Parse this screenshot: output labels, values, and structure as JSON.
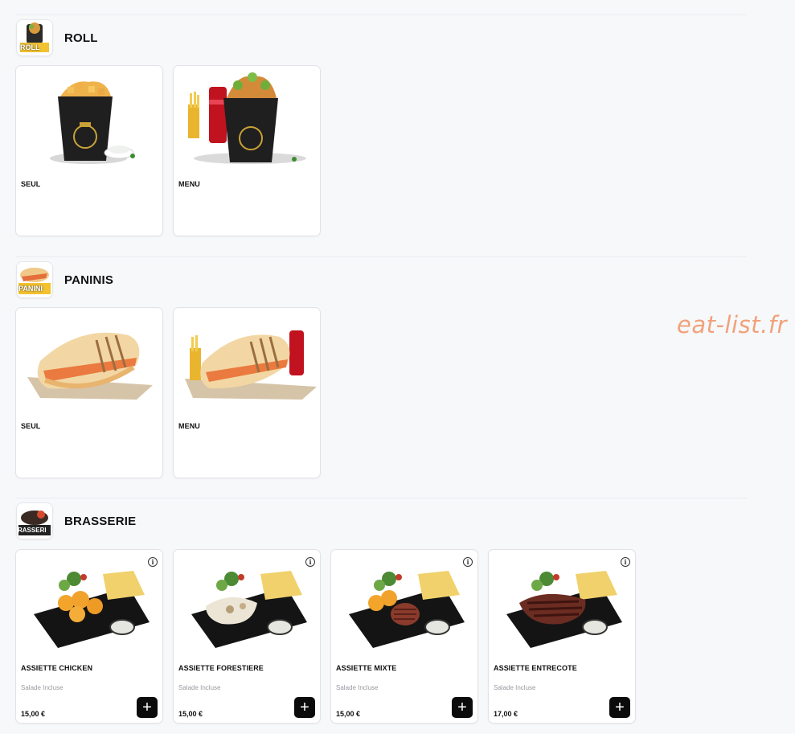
{
  "watermark": "eat-list.fr",
  "sections": [
    {
      "title": "ROLL",
      "icon_text": "ROLL",
      "products": [
        {
          "name": "SEUL"
        },
        {
          "name": "MENU"
        }
      ]
    },
    {
      "title": "PANINIS",
      "icon_text": "PANINI",
      "products": [
        {
          "name": "SEUL"
        },
        {
          "name": "MENU"
        }
      ]
    },
    {
      "title": "BRASSERIE",
      "icon_text": "RASSERI",
      "products": [
        {
          "name": "ASSIETTE CHICKEN",
          "subtitle": "Salade Incluse",
          "price": "15,00 €"
        },
        {
          "name": "ASSIETTE FORESTIERE",
          "subtitle": "Salade Incluse",
          "price": "15,00 €"
        },
        {
          "name": "ASSIETTE MIXTE",
          "subtitle": "Salade Incluse",
          "price": "15,00 €"
        },
        {
          "name": "ASSIETTE ENTRECOTE",
          "subtitle": "Salade Incluse",
          "price": "17,00 €"
        }
      ],
      "add_label": "+",
      "info_label": "i"
    }
  ],
  "colors": {
    "background": "#f7f8fa",
    "watermark": "#f0a27a",
    "button": "#0b0b0b"
  }
}
